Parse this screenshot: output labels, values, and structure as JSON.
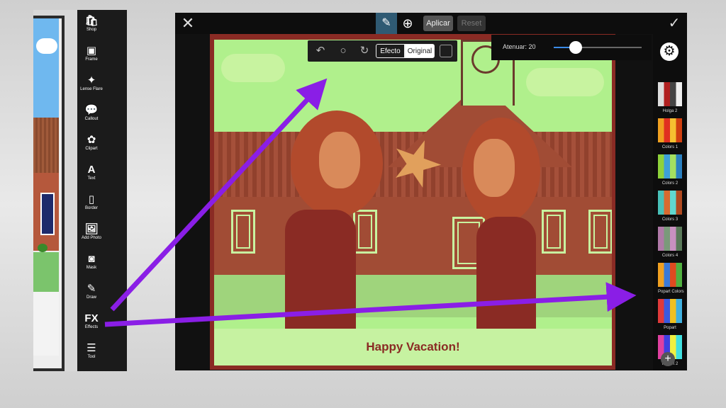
{
  "left_toolbar": {
    "items": [
      {
        "label": "Shop",
        "icon": "shop-icon",
        "glyph": "🛍"
      },
      {
        "label": "Frame",
        "icon": "frame-icon",
        "glyph": "▣"
      },
      {
        "label": "Lense Flare",
        "icon": "lens-flare-icon",
        "glyph": "✦"
      },
      {
        "label": "Callout",
        "icon": "callout-icon",
        "glyph": "💬"
      },
      {
        "label": "Clipart",
        "icon": "clipart-icon",
        "glyph": "✿"
      },
      {
        "label": "Text",
        "icon": "text-icon",
        "glyph": "A"
      },
      {
        "label": "Border",
        "icon": "border-icon",
        "glyph": "▯"
      },
      {
        "label": "Add Photo",
        "icon": "add-photo-icon",
        "glyph": "🖼"
      },
      {
        "label": "Mask",
        "icon": "mask-icon",
        "glyph": "◙"
      },
      {
        "label": "Draw",
        "icon": "draw-icon",
        "glyph": "✎"
      },
      {
        "label": "Effects",
        "icon": "fx-icon",
        "glyph": "FX"
      },
      {
        "label": "Tool",
        "icon": "tool-icon",
        "glyph": "☰"
      }
    ]
  },
  "editor": {
    "close_glyph": "✕",
    "brush_glyph": "✎",
    "target_glyph": "⊕",
    "apply_label": "Aplicar",
    "reset_label": "Reset",
    "done_glyph": "✓",
    "subbar": {
      "undo_glyph": "↶",
      "circle_glyph": "○",
      "redo_glyph": "↻",
      "effect_label": "Efecto",
      "original_label": "Original"
    },
    "fade": {
      "label": "Atenuar: 20",
      "value": 0.25
    },
    "photo_caption": "Happy Vacation!",
    "gear_glyph": "⚙",
    "add_glyph": "+",
    "effects": [
      {
        "label": "Holga 2",
        "colors": [
          "#ddd",
          "#b02020",
          "#444",
          "#eee"
        ]
      },
      {
        "label": "Colors 1",
        "colors": [
          "#f0a020",
          "#e03020",
          "#f6c030",
          "#d04010"
        ]
      },
      {
        "label": "Colors 2",
        "colors": [
          "#8ed23a",
          "#3da0d8",
          "#a4e060",
          "#2a80c0"
        ]
      },
      {
        "label": "Colors 3",
        "colors": [
          "#48c0b8",
          "#d86a30",
          "#60d8d0",
          "#b04a20"
        ]
      },
      {
        "label": "Colors 4",
        "colors": [
          "#b07aa8",
          "#7a9a7a",
          "#c890c0",
          "#5a7a5a"
        ]
      },
      {
        "label": "Popart Colors",
        "colors": [
          "#f0a020",
          "#3a7ad8",
          "#e04a20",
          "#50b040"
        ]
      },
      {
        "label": "Popart",
        "colors": [
          "#e03a3a",
          "#3a5ae0",
          "#f0c020",
          "#40b0e0"
        ]
      },
      {
        "label": "Popart 2",
        "colors": [
          "#e040a0",
          "#4040e0",
          "#f0f040",
          "#40e0e0"
        ]
      }
    ]
  },
  "colors": {
    "arrow": "#8a1ee6",
    "active_tool": "#2f5a73",
    "slider_fill": "#3b8be8"
  }
}
